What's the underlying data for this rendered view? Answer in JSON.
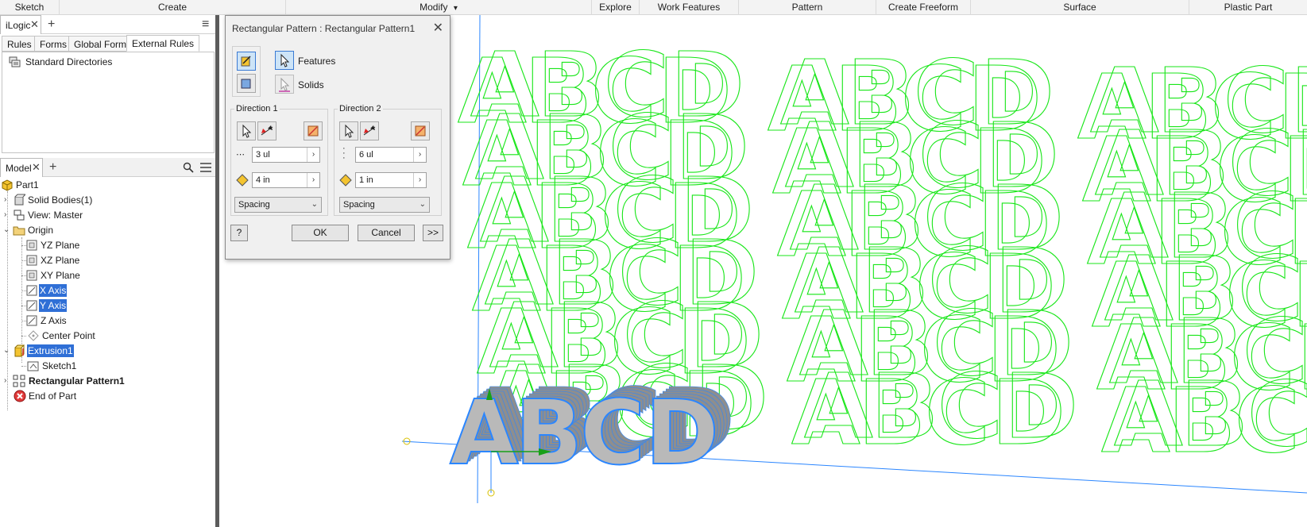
{
  "ribbon": {
    "tabs": [
      "Sketch",
      "Create",
      "Modify",
      "Explore",
      "Work Features",
      "Pattern",
      "Create Freeform",
      "Surface",
      "Plastic Part"
    ],
    "modify_arrow": "▾"
  },
  "ilogic": {
    "title": "iLogic",
    "close": "✕",
    "add": "+",
    "menu": "≡",
    "tabs": [
      "Rules",
      "Forms",
      "Global Forms",
      "External Rules"
    ],
    "active_tab": "External Rules",
    "items": [
      "Standard Directories"
    ]
  },
  "model": {
    "title": "Model",
    "close": "✕",
    "add": "+",
    "tree": [
      {
        "label": "Part1",
        "level": 0,
        "icon": "part-icon"
      },
      {
        "label": "Solid Bodies(1)",
        "level": 1,
        "icon": "solid-bodies-icon"
      },
      {
        "label": "View: Master",
        "level": 1,
        "icon": "view-icon"
      },
      {
        "label": "Origin",
        "level": 1,
        "icon": "folder-icon"
      },
      {
        "label": "YZ Plane",
        "level": 2,
        "icon": "plane-icon"
      },
      {
        "label": "XZ Plane",
        "level": 2,
        "icon": "plane-icon"
      },
      {
        "label": "XY Plane",
        "level": 2,
        "icon": "plane-icon"
      },
      {
        "label": "X Axis",
        "level": 2,
        "icon": "axis-icon",
        "selected": true
      },
      {
        "label": "Y Axis",
        "level": 2,
        "icon": "axis-icon",
        "selected": true
      },
      {
        "label": "Z Axis",
        "level": 2,
        "icon": "axis-icon"
      },
      {
        "label": "Center Point",
        "level": 2,
        "icon": "point-icon"
      },
      {
        "label": "Extrusion1",
        "level": 1,
        "icon": "extrusion-icon",
        "selected": true
      },
      {
        "label": "Sketch1",
        "level": 2,
        "icon": "sketch-icon"
      },
      {
        "label": "Rectangular Pattern1",
        "level": 1,
        "icon": "pattern-icon",
        "bold": true
      },
      {
        "label": "End of Part",
        "level": 1,
        "icon": "end-of-part-icon"
      }
    ]
  },
  "dialog": {
    "title": "Rectangular Pattern : Rectangular Pattern1",
    "close": "✕",
    "features_label": "Features",
    "solids_label": "Solids",
    "direction1": {
      "title": "Direction 1",
      "count": "3 ul",
      "spacing": "4 in",
      "method": "Spacing"
    },
    "direction2": {
      "title": "Direction 2",
      "count": "6 ul",
      "spacing": "1 in",
      "method": "Spacing"
    },
    "ok": "OK",
    "cancel": "Cancel",
    "more": ">>",
    "help": "?"
  },
  "scene": {
    "letters": [
      "A",
      "B",
      "C",
      "D"
    ],
    "instance_color": "#19e619",
    "solid_fill": "#b9b9b9",
    "solid_edge": "#2b86ff"
  }
}
